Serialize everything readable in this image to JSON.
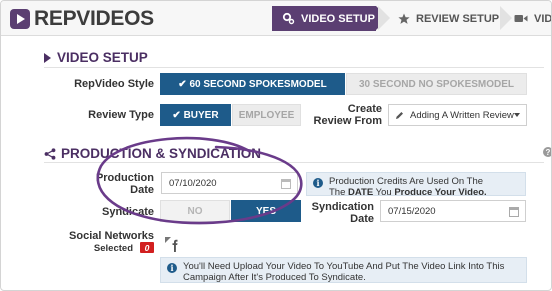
{
  "brand": {
    "name": "REPVIDEOS"
  },
  "steps": [
    {
      "label": "VIDEO SETUP",
      "icon": "gears-icon",
      "active": true
    },
    {
      "label": "REVIEW SETUP",
      "icon": "star-icon",
      "active": false
    },
    {
      "label": "VIDEO",
      "icon": "video-camera-icon",
      "active": false
    }
  ],
  "video_setup": {
    "title": "VIDEO SETUP",
    "style_label": "RepVideo Style",
    "style_options": [
      "✔ 60 SECOND SPOKESMODEL",
      "30 SECOND NO SPOKESMODEL"
    ],
    "review_type_label": "Review Type",
    "review_type_options": [
      "✔ BUYER",
      "EMPLOYEE"
    ],
    "create_review_label_1": "Create",
    "create_review_label_2": "Review From",
    "create_review_value": "Adding A Written Review"
  },
  "production": {
    "title": "PRODUCTION & SYNDICATION",
    "production_date_label_1": "Production",
    "production_date_label_2": "Date",
    "production_date_value": "07/10/2020",
    "production_info_1": "Production Credits Are Used On The",
    "production_info_2_pre": "The ",
    "production_info_2_bold1": "DATE",
    "production_info_2_mid": " You ",
    "production_info_2_bold2": "Produce Your Video.",
    "syndicate_label": "Syndicate",
    "syndicate_options": [
      "NO",
      "YES"
    ],
    "syndication_date_label_1": "Syndication",
    "syndication_date_label_2": "Date",
    "syndication_date_value": "07/15/2020",
    "social_label": "Social Networks",
    "selected_label": "Selected",
    "selected_count": "0",
    "youtube_info_1": "You'll Need Upload Your Video To YouTube And Put The Video Link Into This",
    "youtube_info_2": "Campaign After It's Produced To Syndicate.",
    "help": "?"
  },
  "colors": {
    "accent": "#5b3f72",
    "primary": "#1e5b8a",
    "badge": "#d21f1f"
  }
}
